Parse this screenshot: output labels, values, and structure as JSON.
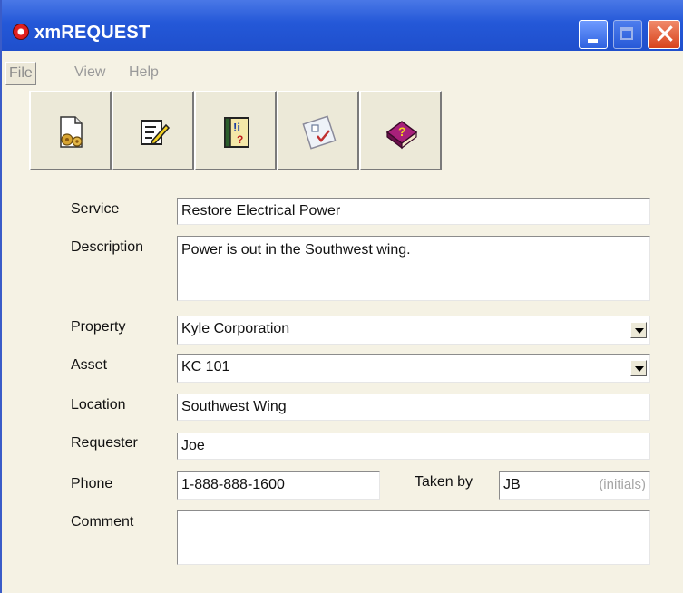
{
  "window": {
    "title": "xmREQUEST"
  },
  "menu": {
    "file": "File",
    "view": "View",
    "help": "Help"
  },
  "toolbar": [
    {
      "icon": "new-request-icon"
    },
    {
      "icon": "edit-icon"
    },
    {
      "icon": "info-book-icon"
    },
    {
      "icon": "checklist-icon"
    },
    {
      "icon": "help-book-icon"
    }
  ],
  "form": {
    "service": {
      "label": "Service",
      "value": "Restore Electrical Power"
    },
    "description": {
      "label": "Description",
      "value": "Power is out in the Southwest wing."
    },
    "property": {
      "label": "Property",
      "value": "Kyle Corporation"
    },
    "asset": {
      "label": "Asset",
      "value": "KC 101"
    },
    "location": {
      "label": "Location",
      "value": "Southwest Wing"
    },
    "requester": {
      "label": "Requester",
      "value": "Joe"
    },
    "phone": {
      "label": "Phone",
      "value": "1-888-888-1600"
    },
    "taken_by": {
      "label": "Taken by",
      "value": "JB",
      "hint": "(initials)"
    },
    "comment": {
      "label": "Comment",
      "value": ""
    }
  },
  "colors": {
    "titlebar": "#2458d8",
    "window_bg": "#f5f2e4",
    "close_button": "#d8431c"
  }
}
